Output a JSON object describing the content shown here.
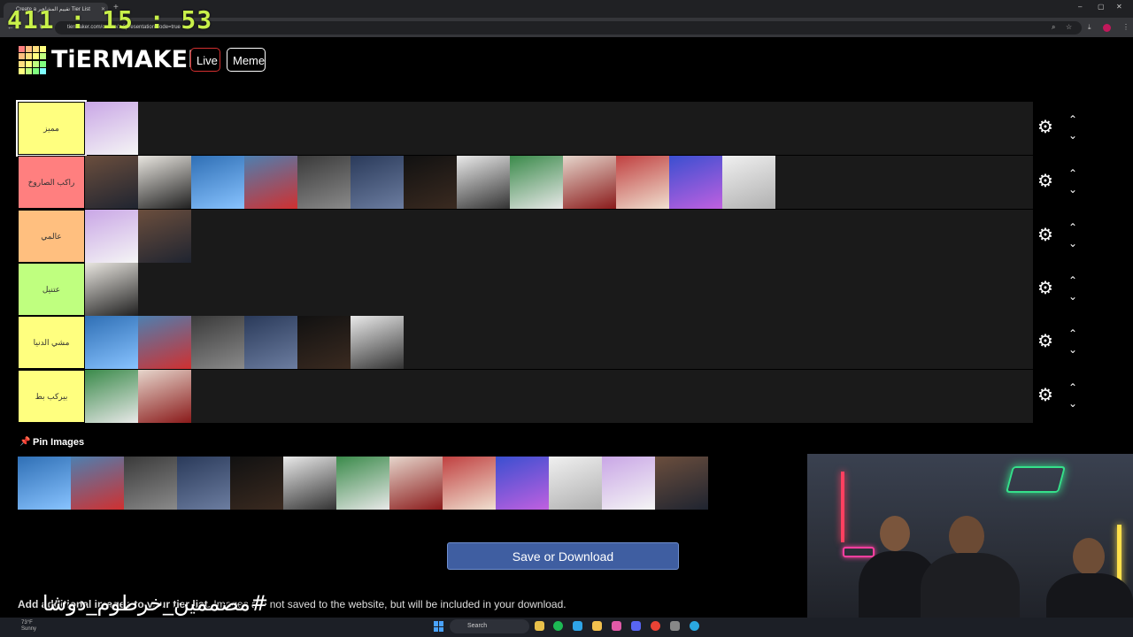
{
  "browser": {
    "tab_title": "Create a تقييم المشاهير Tier List",
    "url": "tiermaker.com/create/...?presentationMode=true"
  },
  "timer": "411 : 15 : 53",
  "header": {
    "logo_text": "TiERMAKER",
    "live_label": "Live",
    "meme_label": "Meme"
  },
  "tiers": [
    {
      "label": "مميز",
      "color": "#ffff7f",
      "items": 1
    },
    {
      "label": "راكب الصاروخ",
      "color": "#ff7f7f",
      "items": 13
    },
    {
      "label": "عالمي",
      "color": "#ffbf7f",
      "items": 2
    },
    {
      "label": "عتنيل",
      "color": "#bfff7f",
      "items": 1
    },
    {
      "label": "مشي الدنيا",
      "color": "#ffff7f",
      "items": 6
    },
    {
      "label": "بيركب بط",
      "color": "#ffff7f",
      "items": 2
    }
  ],
  "pin_label": "Pin Images",
  "pool_items": 13,
  "save_label": "Save or Download",
  "info": {
    "bold": "Add additional images to your tier list.",
    "rest": " Images are not saved to the website, but will be included in your download."
  },
  "overlay_text": "#مصممين_خرطوم_دوشا",
  "taskbar": {
    "weather_temp": "73°F",
    "weather_desc": "Sunny",
    "search_placeholder": "Search"
  }
}
